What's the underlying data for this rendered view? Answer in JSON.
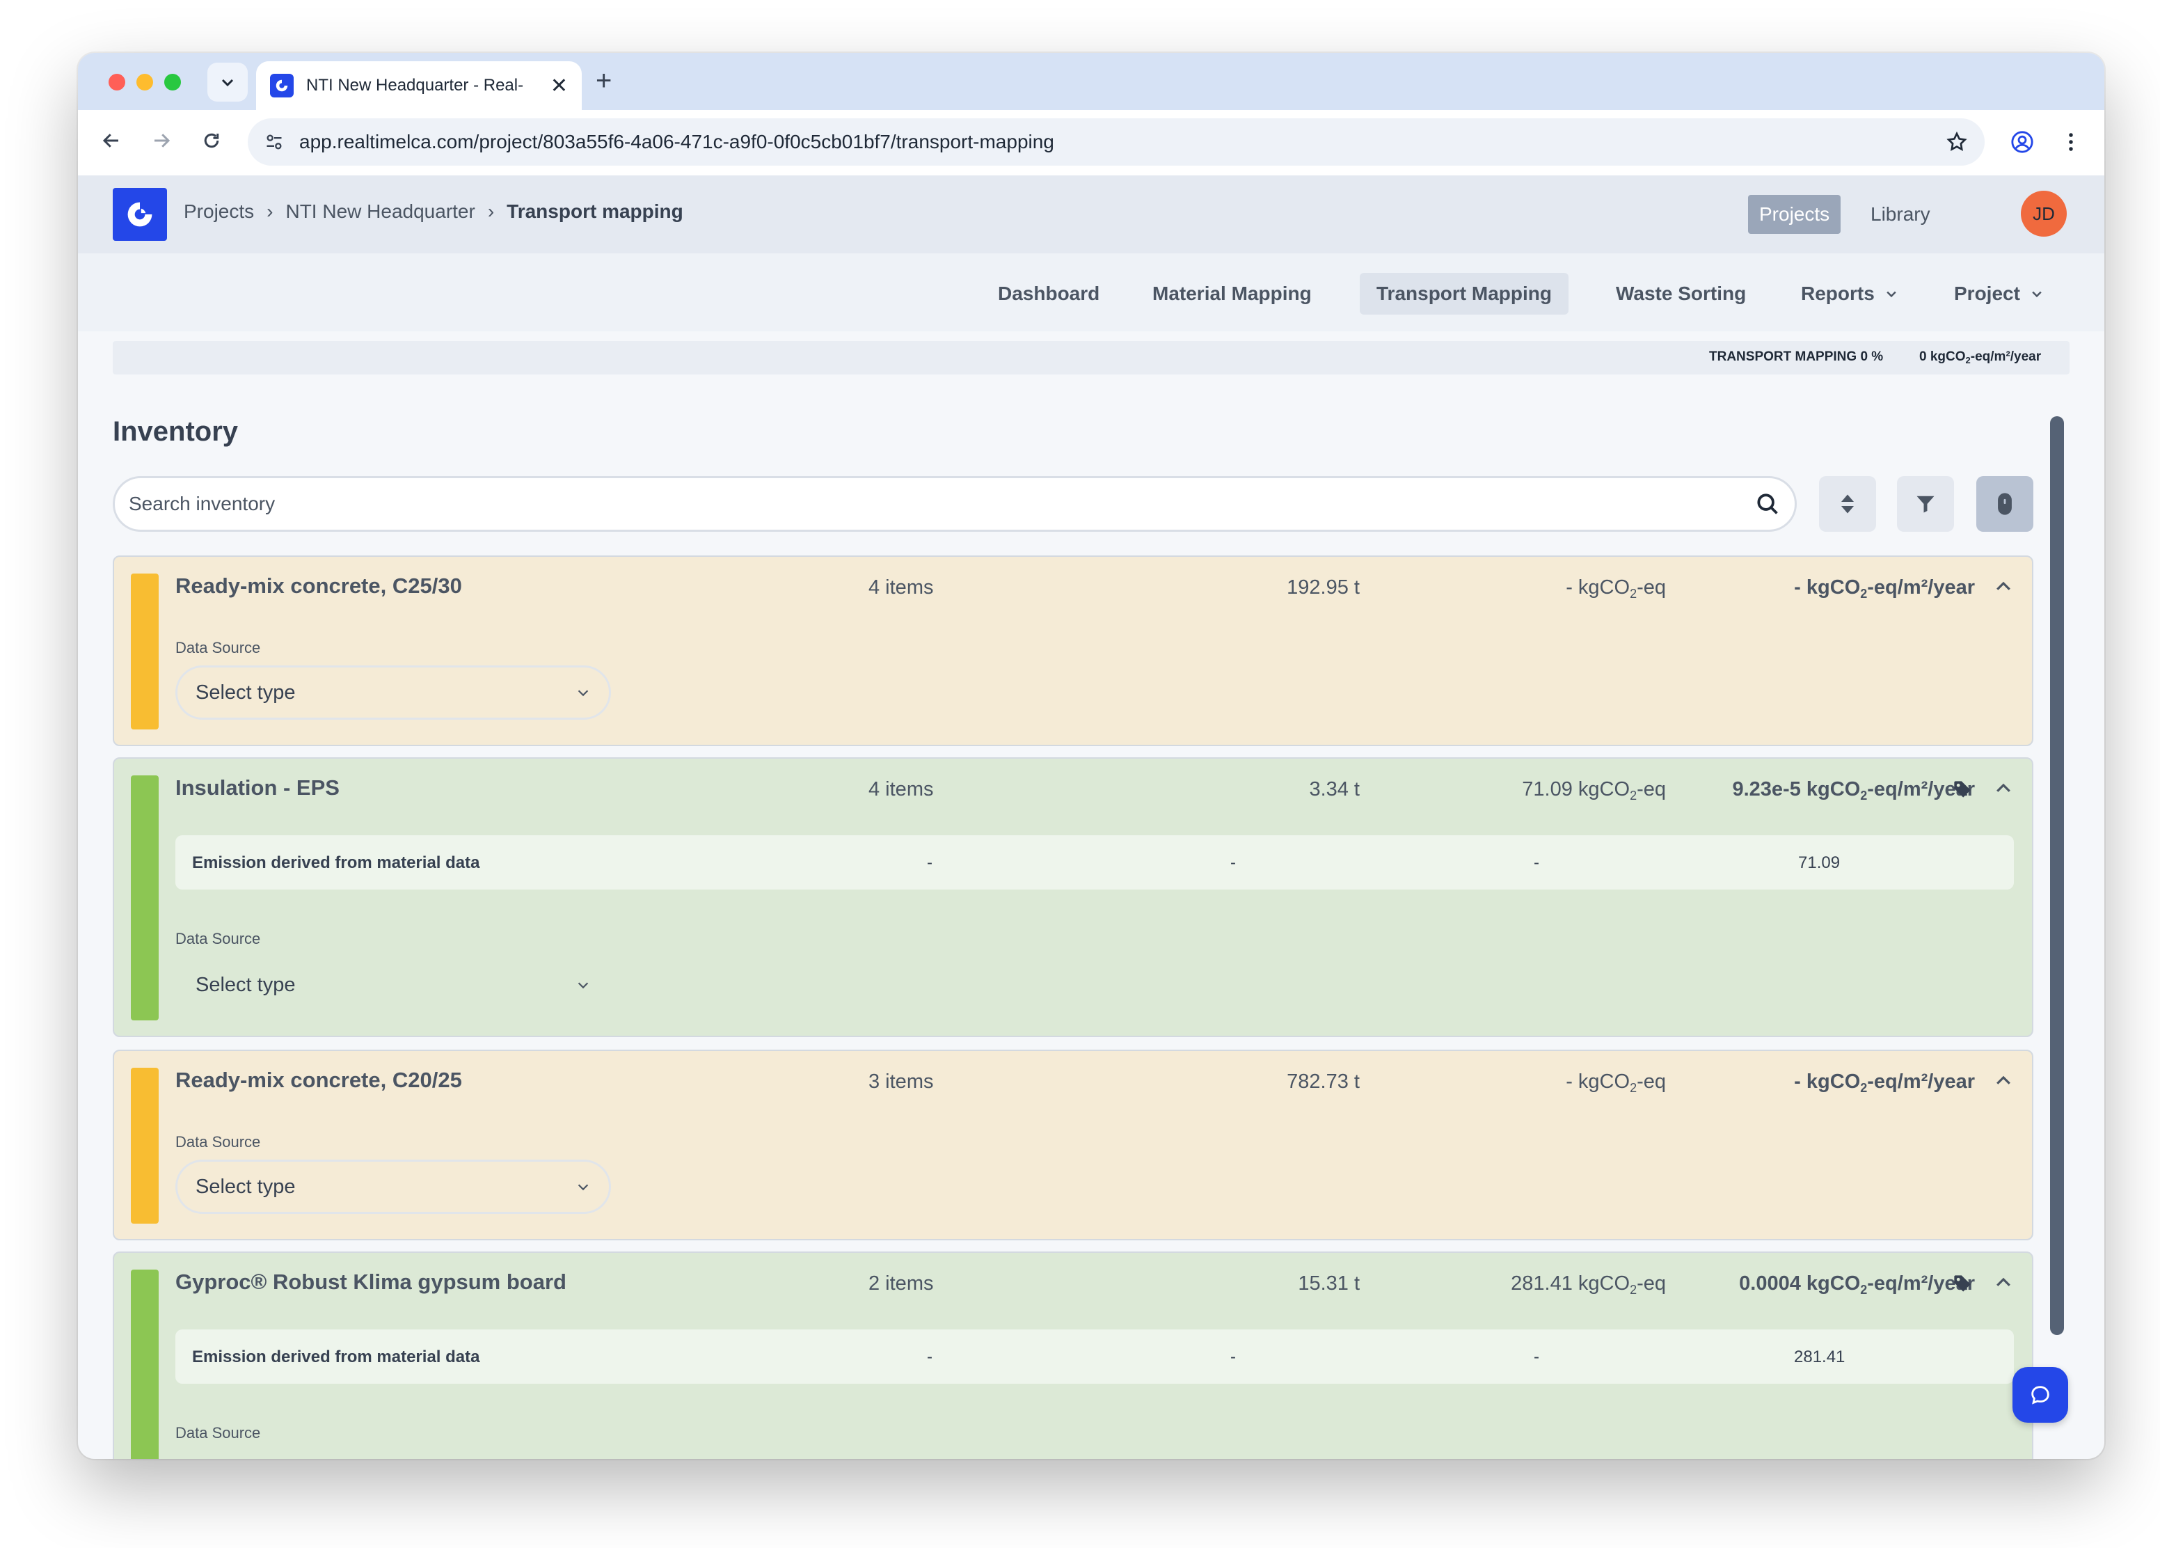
{
  "browser": {
    "tab_title": "NTI New Headquarter - Real-",
    "url": "app.realtimelca.com/project/803a55f6-4a06-471c-a9f0-0f0c5cb01bf7/transport-mapping"
  },
  "header": {
    "breadcrumbs": [
      "Projects",
      "NTI New Headquarter",
      "Transport mapping"
    ],
    "projects_button": "Projects",
    "library_link": "Library",
    "avatar_initials": "JD"
  },
  "subnav": {
    "dashboard": "Dashboard",
    "material_mapping": "Material Mapping",
    "transport_mapping": "Transport Mapping",
    "waste_sorting": "Waste Sorting",
    "reports": "Reports",
    "project": "Project"
  },
  "status": {
    "transport_mapping": "TRANSPORT MAPPING 0 %",
    "emission_prefix": "0 kgCO",
    "emission_sub": "2",
    "emission_suffix": "-eq/m²/year"
  },
  "inventory": {
    "title": "Inventory",
    "search_placeholder": "Search inventory",
    "co2_prefix": "kgCO",
    "co2_sub": "2",
    "eq_suffix": "-eq",
    "annual_suffix": "-eq/m²/year",
    "data_source_label": "Data Source",
    "select_placeholder": "Select type",
    "derived_label": "Emission derived from material data",
    "items": [
      {
        "name": "Ready-mix concrete, C25/30",
        "count": "4 items",
        "mass": "192.95 t",
        "emission": "-",
        "annual": "-"
      },
      {
        "name": "Insulation - EPS",
        "count": "4 items",
        "mass": "3.34 t",
        "emission": "71.09",
        "annual": "9.23e-5",
        "derived": [
          "-",
          "-",
          "-",
          "71.09"
        ]
      },
      {
        "name": "Ready-mix concrete, C20/25",
        "count": "3 items",
        "mass": "782.73 t",
        "emission": "-",
        "annual": "-"
      },
      {
        "name": "Gyproc® Robust Klima gypsum board",
        "count": "2 items",
        "mass": "15.31 t",
        "emission": "281.41",
        "annual": "0.0004",
        "derived": [
          "-",
          "-",
          "-",
          "281.41"
        ]
      }
    ]
  }
}
